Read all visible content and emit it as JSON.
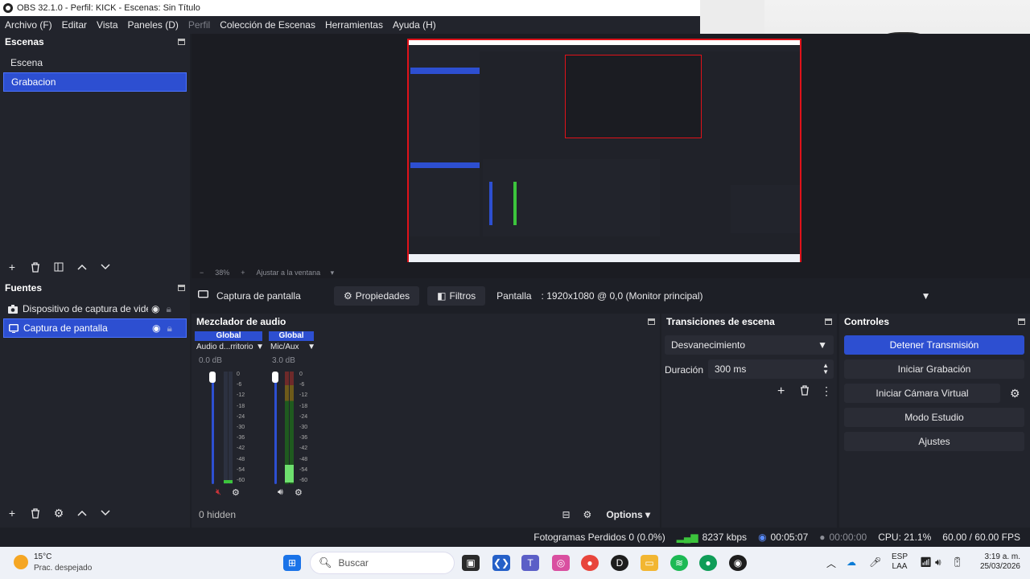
{
  "window": {
    "title": "OBS 32.1.0 - Perfil: KICK - Escenas: Sin Título"
  },
  "menu": [
    "Archivo (F)",
    "Editar",
    "Vista",
    "Paneles (D)",
    "Perfil",
    "Colección de Escenas",
    "Herramientas",
    "Ayuda (H)"
  ],
  "scenes": {
    "title": "Escenas",
    "items": [
      "Escena",
      "Grabacion"
    ],
    "selected_index": 1
  },
  "sources": {
    "title": "Fuentes",
    "items": [
      "Dispositivo de captura de video",
      "Captura de pantalla"
    ],
    "selected_index": 1
  },
  "zoom": {
    "minus": "−",
    "value": "38%",
    "plus": "+",
    "fit": "Ajustar a la ventana"
  },
  "source_bar": {
    "name": "Captura de pantalla",
    "properties": "Propiedades",
    "filters": "Filtros",
    "display_label": "Pantalla",
    "display_value": ": 1920x1080 @ 0,0 (Monitor principal)"
  },
  "mixer": {
    "title": "Mezclador de audio",
    "channels": [
      {
        "badge": "Global",
        "name": "Audio d...rritorio",
        "db": "0.0 dB",
        "level": 0.0,
        "muted": true
      },
      {
        "badge": "Global",
        "name": "Mic/Aux",
        "db": "3.0 dB",
        "level": 0.0,
        "muted": false
      }
    ],
    "ticks": [
      "0",
      "-6",
      "-12",
      "-18",
      "-24",
      "-30",
      "-36",
      "-42",
      "-48",
      "-54",
      "-60"
    ],
    "hidden": "0 hidden",
    "options": "Options"
  },
  "transitions": {
    "title": "Transiciones de escena",
    "selected": "Desvanecimiento",
    "duration_label": "Duración",
    "duration_value": "300 ms"
  },
  "controls": {
    "title": "Controles",
    "stream": "Detener Transmisión",
    "record": "Iniciar Grabación",
    "virtualcam": "Iniciar Cámara Virtual",
    "studio": "Modo Estudio",
    "settings": "Ajustes"
  },
  "status": {
    "dropped": "Fotogramas Perdidos 0 (0.0%)",
    "bitrate": "8237 kbps",
    "stream_time": "00:05:07",
    "rec_time": "00:00:00",
    "cpu": "CPU: 21.1%",
    "fps": "60.00 / 60.00 FPS"
  },
  "taskbar": {
    "temp": "15°C",
    "weather": "Prac. despejado",
    "search": "Buscar",
    "lang1": "ESP",
    "lang2": "LAA",
    "time": "3:19 a. m.",
    "date": "25/03/2026"
  },
  "colors": {
    "accent": "#2d4fd1",
    "panel": "#22242c",
    "bg": "#1d1f26",
    "red_border": "#e0121a",
    "status_green": "#3cc43c"
  }
}
